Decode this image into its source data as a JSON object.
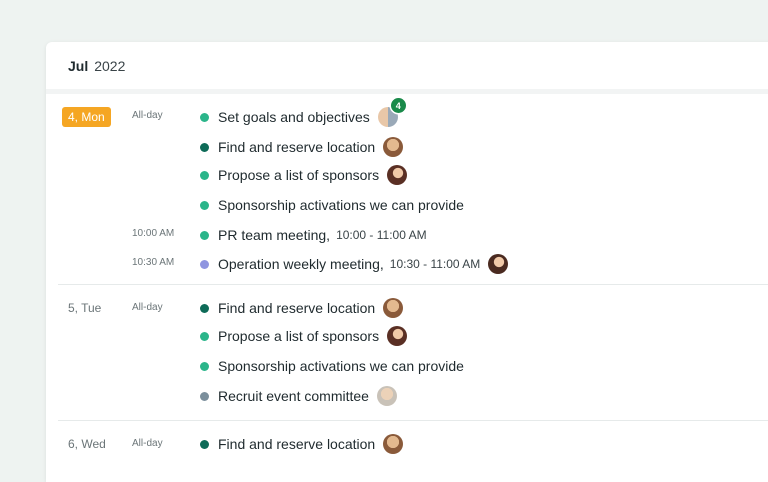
{
  "header": {
    "month": "Jul",
    "year": "2022"
  },
  "colors": {
    "today": "#f5a623",
    "teal": "#2bb58a",
    "dark_green": "#0e6b58",
    "purple": "#8f95e0",
    "gray_blue": "#7b8f9c",
    "badge": "#1a8a4a"
  },
  "days": [
    {
      "label": "4, Mon",
      "events": [
        {
          "time": "All-day",
          "title": "Set goals and objectives",
          "color": "#2bb58a",
          "avatar": "person-pair-avatar",
          "badge": "4"
        },
        {
          "title": "Find and reserve location",
          "color": "#0e6b58",
          "avatar": "man-avatar"
        },
        {
          "title": "Propose a list of sponsors",
          "color": "#2bb58a",
          "avatar": "woman-avatar"
        },
        {
          "title": "Sponsorship activations we can provide",
          "color": "#2bb58a"
        },
        {
          "time": "10:00 AM",
          "title": "PR team meeting,",
          "range": "10:00 - 11:00 AM",
          "color": "#2bb58a"
        },
        {
          "time": "10:30 AM",
          "title": "Operation weekly meeting,",
          "range": "10:30 - 11:00 AM",
          "color": "#8f95e0",
          "avatar": "woman-avatar"
        }
      ]
    },
    {
      "label": "5, Tue",
      "events": [
        {
          "time": "All-day",
          "title": "Find and reserve location",
          "color": "#0e6b58",
          "avatar": "man-avatar"
        },
        {
          "title": "Propose a list of sponsors",
          "color": "#2bb58a",
          "avatar": "woman-avatar"
        },
        {
          "title": "Sponsorship activations we can provide",
          "color": "#2bb58a"
        },
        {
          "title": "Recruit event committee",
          "color": "#7b8f9c",
          "avatar": "older-man-avatar"
        }
      ]
    },
    {
      "label": "6, Wed",
      "events": [
        {
          "time": "All-day",
          "title": "Find and reserve location",
          "color": "#0e6b58",
          "avatar": "man-avatar"
        }
      ]
    }
  ]
}
